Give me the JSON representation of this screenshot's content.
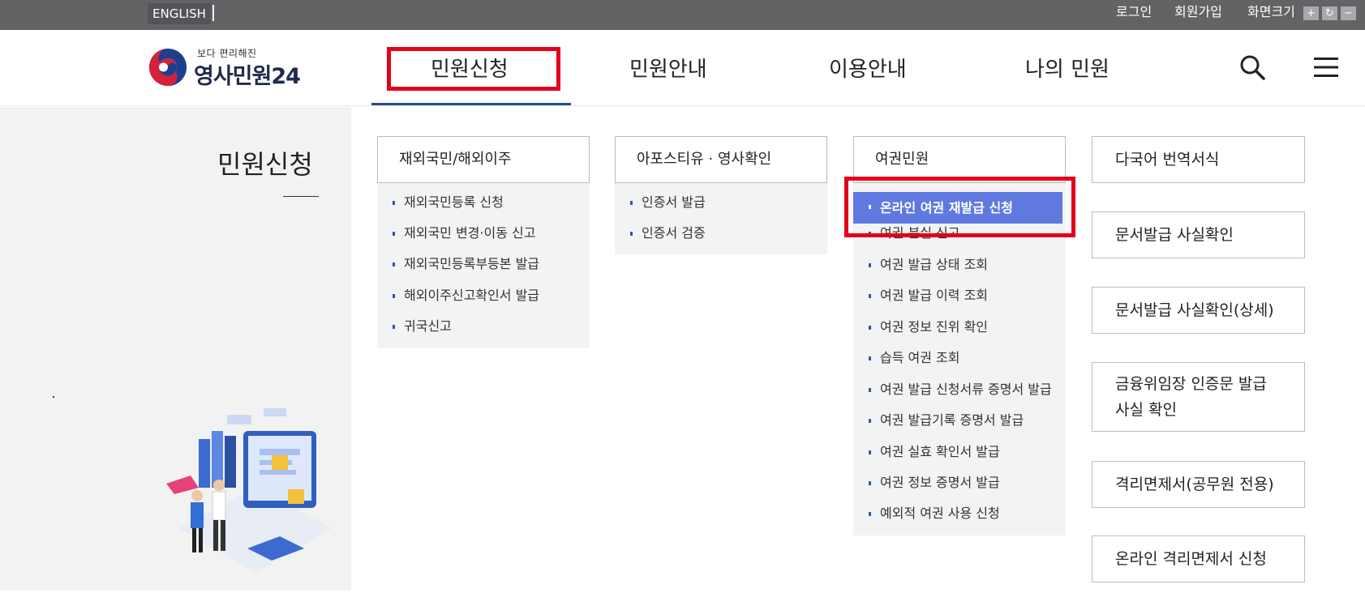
{
  "topbar": {
    "language": "ENGLISH",
    "login": "로그인",
    "signup": "회원가입",
    "font_size": "화면크기",
    "font_plus": "+",
    "font_reset": "↻",
    "font_minus": "−"
  },
  "header": {
    "logo_tagline": "보다 편리해진",
    "logo_name": "영사민원24",
    "nav": [
      "민원신청",
      "민원안내",
      "이용안내",
      "나의 민원"
    ],
    "search_icon": "search-icon",
    "menu_icon": "hamburger-menu-icon"
  },
  "left_panel": {
    "title": "민원신청",
    "dot": "."
  },
  "columns": [
    {
      "heading": "재외국민/해외이주",
      "items": [
        "재외국민등록 신청",
        "재외국민 변경·이동 신고",
        "재외국민등록부등본 발급",
        "해외이주신고확인서 발급",
        "귀국신고"
      ]
    },
    {
      "heading": "아포스티유 · 영사확인",
      "items": [
        "인증서 발급",
        "인증서 검증"
      ]
    },
    {
      "heading": "여권민원",
      "items": [
        "온라인 여권 재발급 신청",
        "여권 분실 신고",
        "여권 발급 상태 조회",
        "여권 발급 이력 조회",
        "여권 정보 진위 확인",
        "습득 여권 조회",
        "여권 발급 신청서류 증명서 발급",
        "여권 발급기록 증명서 발급",
        "여권 실효 확인서 발급",
        "여권 정보 증명서 발급",
        "예외적 여권 사용 신청"
      ]
    }
  ],
  "right_boxes": [
    {
      "line1": "다국어 번역서식",
      "line2": ""
    },
    {
      "line1": "문서발급 사실확인",
      "line2": ""
    },
    {
      "line1": "문서발급 사실확인(상세)",
      "line2": ""
    },
    {
      "line1": "금융위임장 인증문 발급",
      "line2": "사실 확인"
    },
    {
      "line1": "격리면제서(공무원 전용)",
      "line2": ""
    },
    {
      "line1": "온라인 격리면제서 신청",
      "line2": ""
    }
  ],
  "colors": {
    "topbar": "#636366",
    "highlight_red": "#e3001b",
    "active_item": "#5f79e0",
    "nav_underline": "#224b8f"
  }
}
